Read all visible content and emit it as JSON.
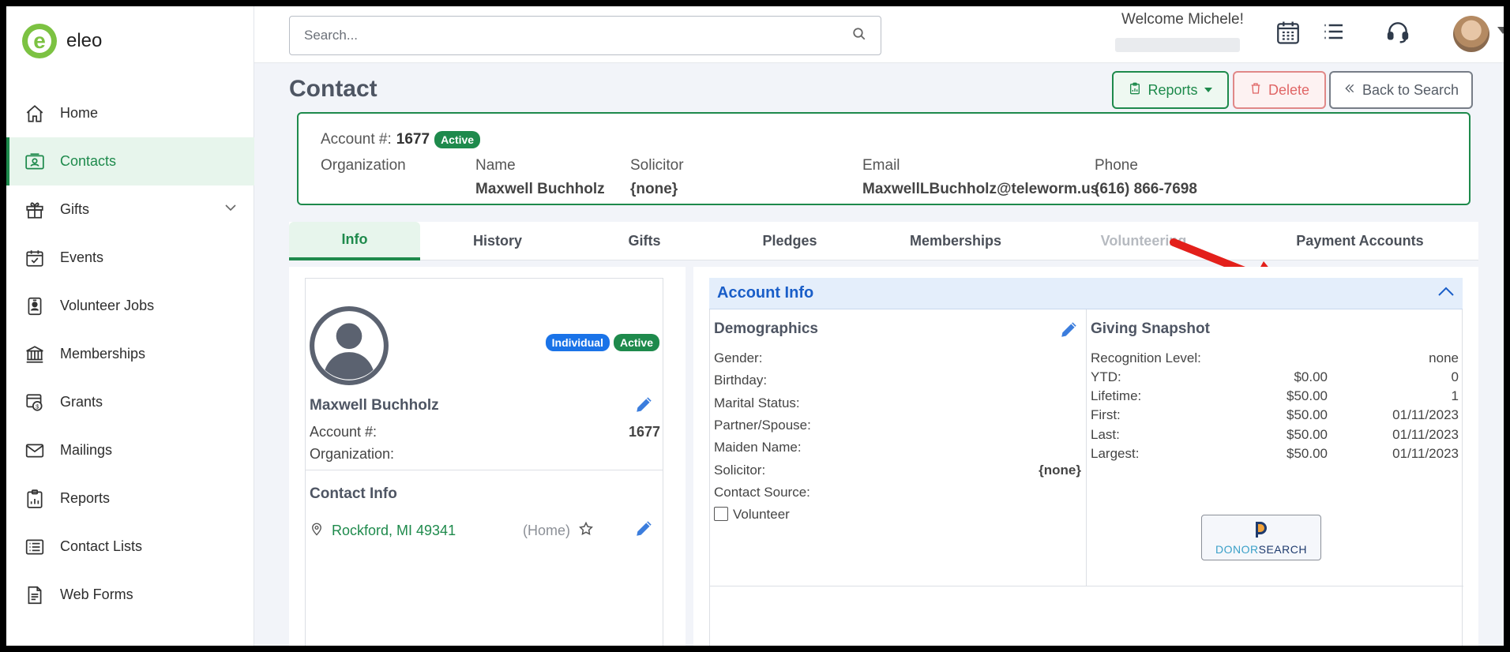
{
  "app": {
    "logo_text": "eleo"
  },
  "sidebar": {
    "items": [
      {
        "label": "Home",
        "icon": "home-icon"
      },
      {
        "label": "Contacts",
        "icon": "contacts-icon",
        "active": true
      },
      {
        "label": "Gifts",
        "icon": "gift-icon"
      },
      {
        "label": "Events",
        "icon": "calendar-check-icon"
      },
      {
        "label": "Volunteer Jobs",
        "icon": "badge-icon"
      },
      {
        "label": "Memberships",
        "icon": "bank-icon"
      },
      {
        "label": "Grants",
        "icon": "grant-icon"
      },
      {
        "label": "Mailings",
        "icon": "envelope-icon"
      },
      {
        "label": "Reports",
        "icon": "report-icon"
      },
      {
        "label": "Contact Lists",
        "icon": "list-icon"
      },
      {
        "label": "Web Forms",
        "icon": "form-icon"
      }
    ]
  },
  "topbar": {
    "search_placeholder": "Search...",
    "welcome": "Welcome Michele!"
  },
  "page": {
    "title": "Contact",
    "reports_label": "Reports",
    "delete_label": "Delete",
    "back_label": "Back to Search"
  },
  "summary": {
    "account_label": "Account #:",
    "account_number": "1677",
    "status": "Active",
    "organization_label": "Organization",
    "name_label": "Name",
    "name": "Maxwell Buchholz",
    "solicitor_label": "Solicitor",
    "solicitor": "{none}",
    "email_label": "Email",
    "email": "MaxwellLBuchholz@teleworm.us",
    "phone_label": "Phone",
    "phone": "(616) 866-7698"
  },
  "tabs": [
    {
      "label": "Info",
      "state": "active"
    },
    {
      "label": "History",
      "state": "normal"
    },
    {
      "label": "Gifts",
      "state": "normal"
    },
    {
      "label": "Pledges",
      "state": "normal"
    },
    {
      "label": "Memberships",
      "state": "normal"
    },
    {
      "label": "Volunteering",
      "state": "disabled"
    },
    {
      "label": "Payment Accounts",
      "state": "normal"
    }
  ],
  "profile": {
    "type_badge": "Individual",
    "status_badge": "Active",
    "name": "Maxwell Buchholz",
    "account_label": "Account #:",
    "account_number": "1677",
    "organization_label": "Organization:",
    "contact_info_title": "Contact Info",
    "address": "Rockford, MI 49341",
    "address_type": "(Home)"
  },
  "account_info": {
    "title": "Account Info",
    "demographics": {
      "title": "Demographics",
      "rows": [
        {
          "label": "Gender:",
          "value": ""
        },
        {
          "label": "Birthday:",
          "value": ""
        },
        {
          "label": "Marital Status:",
          "value": ""
        },
        {
          "label": "Partner/Spouse:",
          "value": ""
        },
        {
          "label": "Maiden Name:",
          "value": ""
        },
        {
          "label": "Solicitor:",
          "value": "{none}"
        },
        {
          "label": "Contact Source:",
          "value": ""
        }
      ],
      "volunteer_label": "Volunteer"
    },
    "giving": {
      "title": "Giving Snapshot",
      "recognition_label": "Recognition Level:",
      "recognition_value": "none",
      "rows": [
        {
          "label": "YTD:",
          "amount": "$0.00",
          "extra": "0"
        },
        {
          "label": "Lifetime:",
          "amount": "$50.00",
          "extra": "1"
        },
        {
          "label": "First:",
          "amount": "$50.00",
          "extra": "01/11/2023"
        },
        {
          "label": "Last:",
          "amount": "$50.00",
          "extra": "01/11/2023"
        },
        {
          "label": "Largest:",
          "amount": "$50.00",
          "extra": "01/11/2023"
        }
      ],
      "donorsearch_a": "DONOR",
      "donorsearch_b": "SEARCH"
    }
  },
  "colors": {
    "brand_green": "#1e8a4c",
    "logo_green": "#7cc242",
    "link_blue": "#1a5ec8",
    "delete_red": "#e06666",
    "arrow_red": "#e3201b"
  }
}
